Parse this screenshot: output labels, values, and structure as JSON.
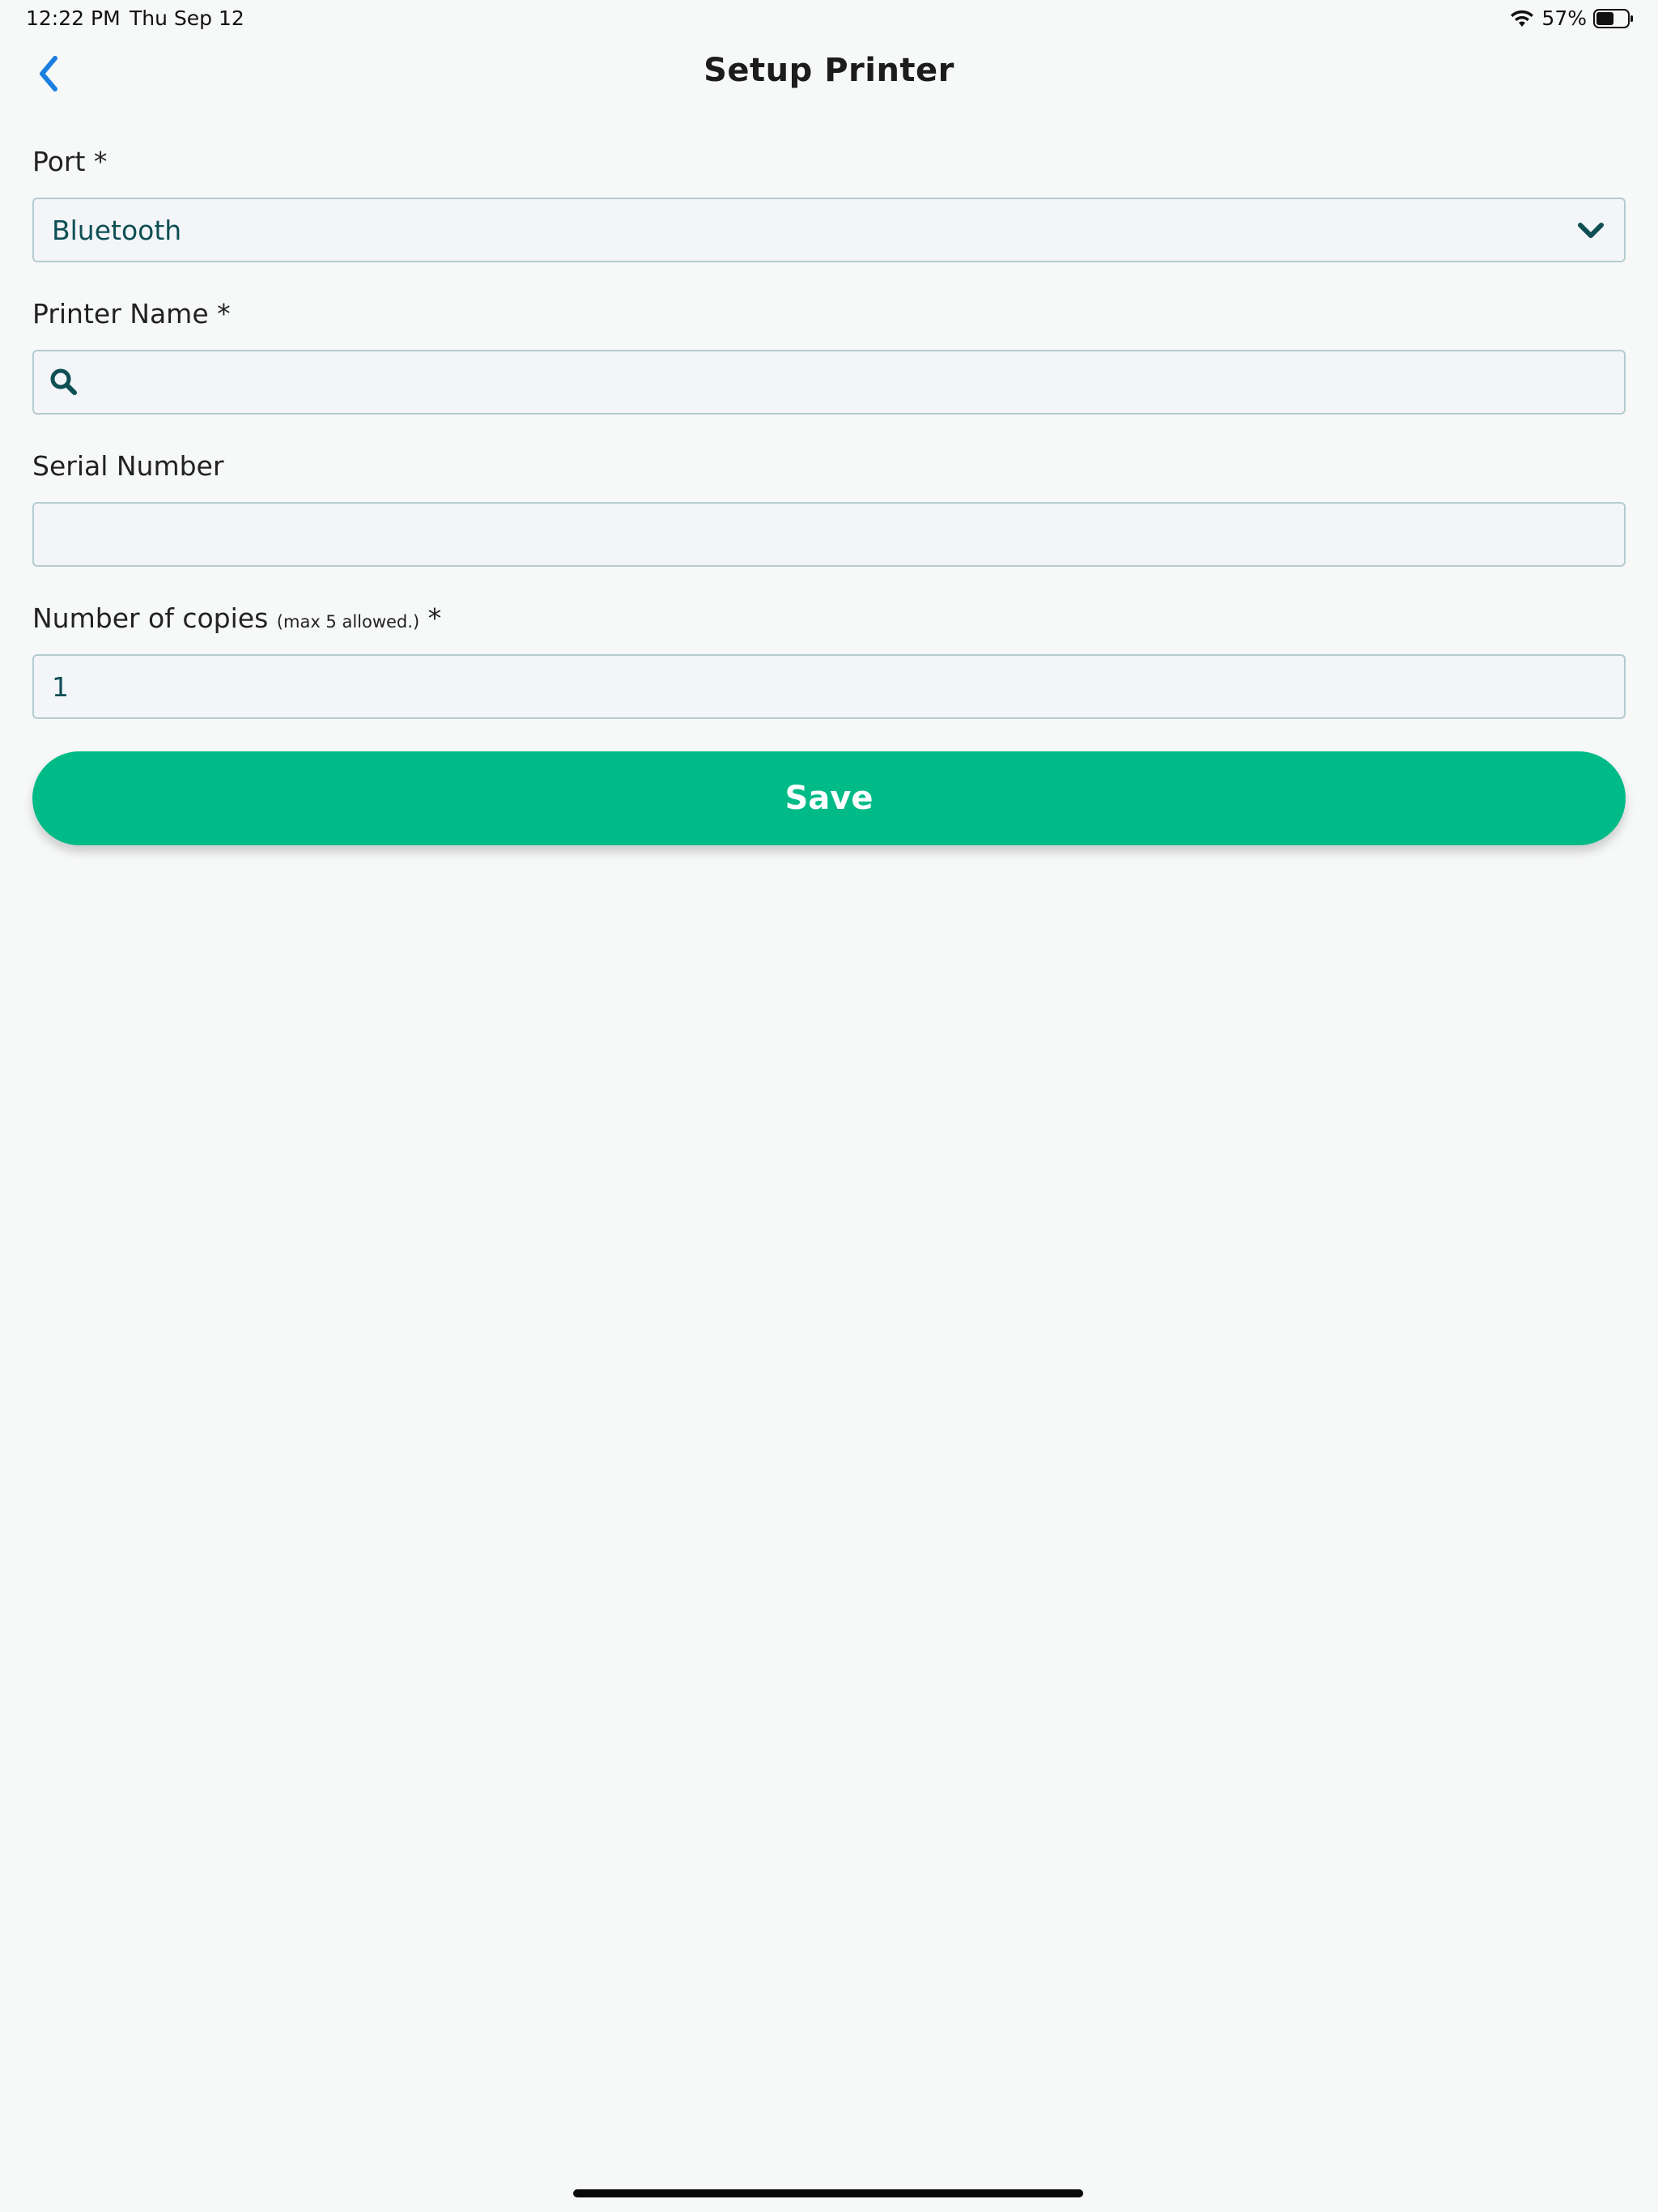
{
  "status_bar": {
    "time": "12:22 PM",
    "date": "Thu Sep 12",
    "battery": "57%",
    "battery_level": 0.57
  },
  "header": {
    "title": "Setup Printer",
    "back_icon": "chevron-left-icon"
  },
  "form": {
    "port": {
      "label": "Port *",
      "value": "Bluetooth",
      "icon": "chevron-down-icon"
    },
    "printer_name": {
      "label": "Printer Name *",
      "value": "",
      "icon": "search-icon"
    },
    "serial_number": {
      "label": "Serial Number",
      "value": ""
    },
    "copies": {
      "label": "Number of copies",
      "hint": "(max 5 allowed.)",
      "required_mark": " *",
      "value": "1"
    }
  },
  "actions": {
    "save_label": "Save"
  },
  "colors": {
    "accent": "#00bb87",
    "back_icon": "#1a7fe0",
    "field_text": "#0e4f54",
    "field_border": "#b5cccf",
    "field_bg": "#f3f5f8",
    "page_bg": "#f7f8f8"
  }
}
